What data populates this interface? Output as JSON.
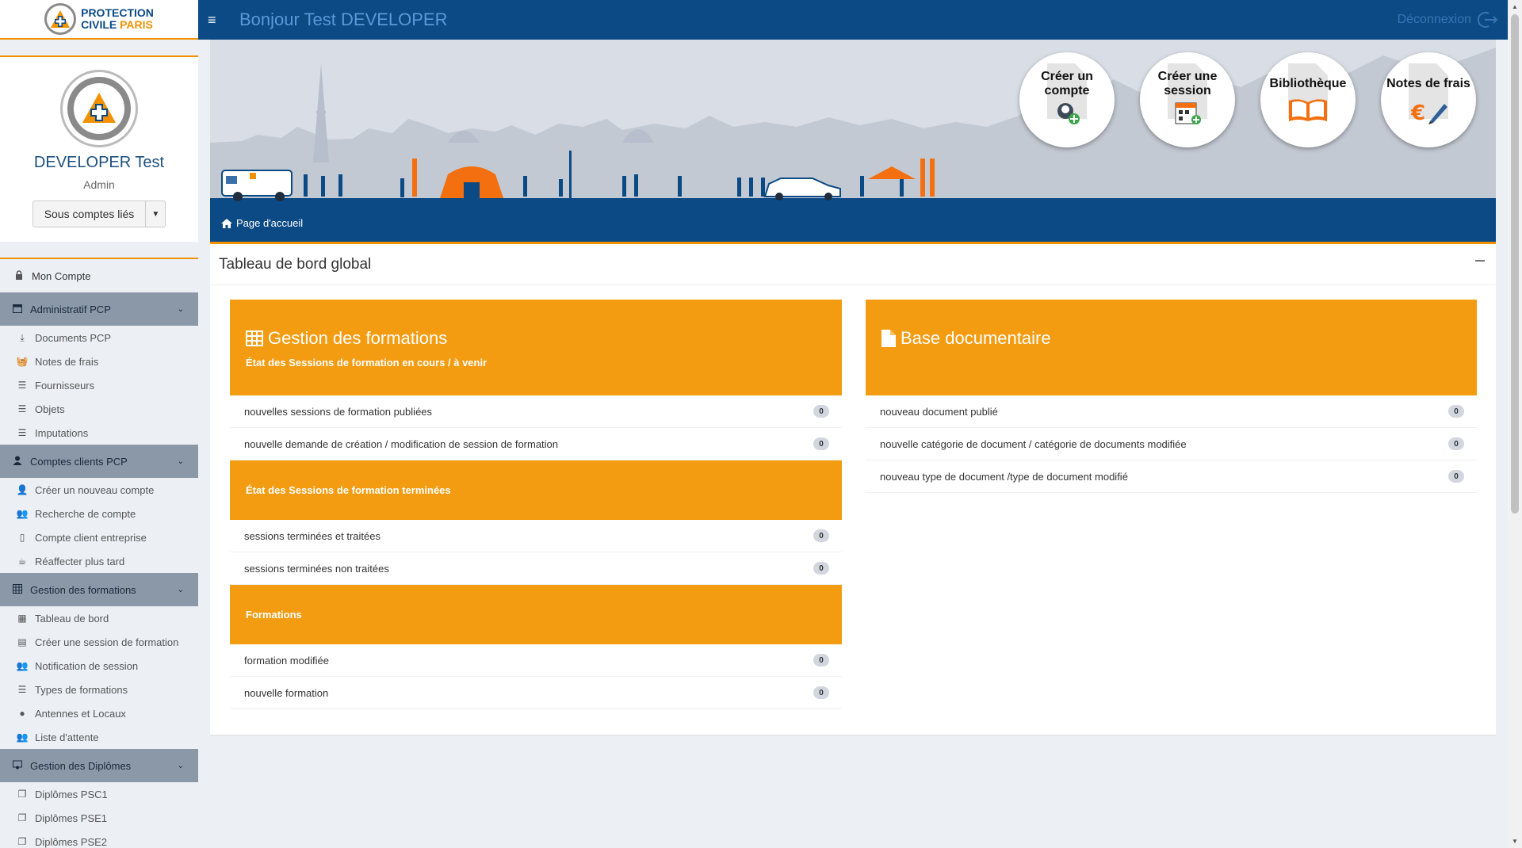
{
  "logo": {
    "line1": "PROTECTION",
    "line2a": "CIVILE",
    "line2b": "PARIS"
  },
  "user": {
    "name": "DEVELOPER Test",
    "role": "Admin",
    "sub_accounts_label": "Sous comptes liés"
  },
  "header": {
    "greeting": "Bonjour Test DEVELOPER",
    "logout_label": "Déconnexion"
  },
  "menu": {
    "my_account": "Mon Compte",
    "sections": [
      {
        "title": "Administratif PCP",
        "items": [
          "Documents PCP",
          "Notes de frais",
          "Fournisseurs",
          "Objets",
          "Imputations"
        ]
      },
      {
        "title": "Comptes clients PCP",
        "items": [
          "Créer un nouveau compte",
          "Recherche de compte",
          "Compte client entreprise",
          "Réaffecter plus tard"
        ]
      },
      {
        "title": "Gestion des formations",
        "items": [
          "Tableau de bord",
          "Créer une session de formation",
          "Notification de session",
          "Types de formations",
          "Antennes et Locaux",
          "Liste d'attente"
        ]
      },
      {
        "title": "Gestion des Diplômes",
        "items": [
          "Diplômes PSC1",
          "Diplômes PSE1",
          "Diplômes PSE2"
        ]
      }
    ]
  },
  "shortcuts": [
    {
      "line1": "Créer un",
      "line2": "compte"
    },
    {
      "line1": "Créer une",
      "line2": "session"
    },
    {
      "line1": "Bibliothèque",
      "line2": ""
    },
    {
      "line1": "Notes de frais",
      "line2": ""
    }
  ],
  "breadcrumb": {
    "home": "Page d'accueil"
  },
  "dashboard": {
    "title": "Tableau de bord global",
    "formations": {
      "title": "Gestion des formations",
      "groups": [
        {
          "subtitle": "État des Sessions de formation en cours / à venir",
          "rows": [
            {
              "label": "nouvelles sessions de formation publiées",
              "count": "0"
            },
            {
              "label": "nouvelle demande de création / modification de session de formation",
              "count": "0"
            }
          ]
        },
        {
          "subtitle": "État des Sessions de formation terminées",
          "rows": [
            {
              "label": "sessions terminées et traitées",
              "count": "0"
            },
            {
              "label": "sessions terminées non traitées",
              "count": "0"
            }
          ]
        },
        {
          "subtitle": "Formations",
          "rows": [
            {
              "label": "formation modifiée",
              "count": "0"
            },
            {
              "label": "nouvelle formation",
              "count": "0"
            }
          ]
        }
      ]
    },
    "documents": {
      "title": "Base documentaire",
      "rows": [
        {
          "label": "nouveau document publié",
          "count": "0"
        },
        {
          "label": "nouvelle catégorie de document / catégorie de documents modifiée",
          "count": "0"
        },
        {
          "label": "nouveau type de document /type de document modifié",
          "count": "0"
        }
      ]
    }
  },
  "colors": {
    "primary": "#0b4a85",
    "accent": "#f39200",
    "panel_orange": "#f39c12",
    "menu_head": "#8a98a8"
  }
}
